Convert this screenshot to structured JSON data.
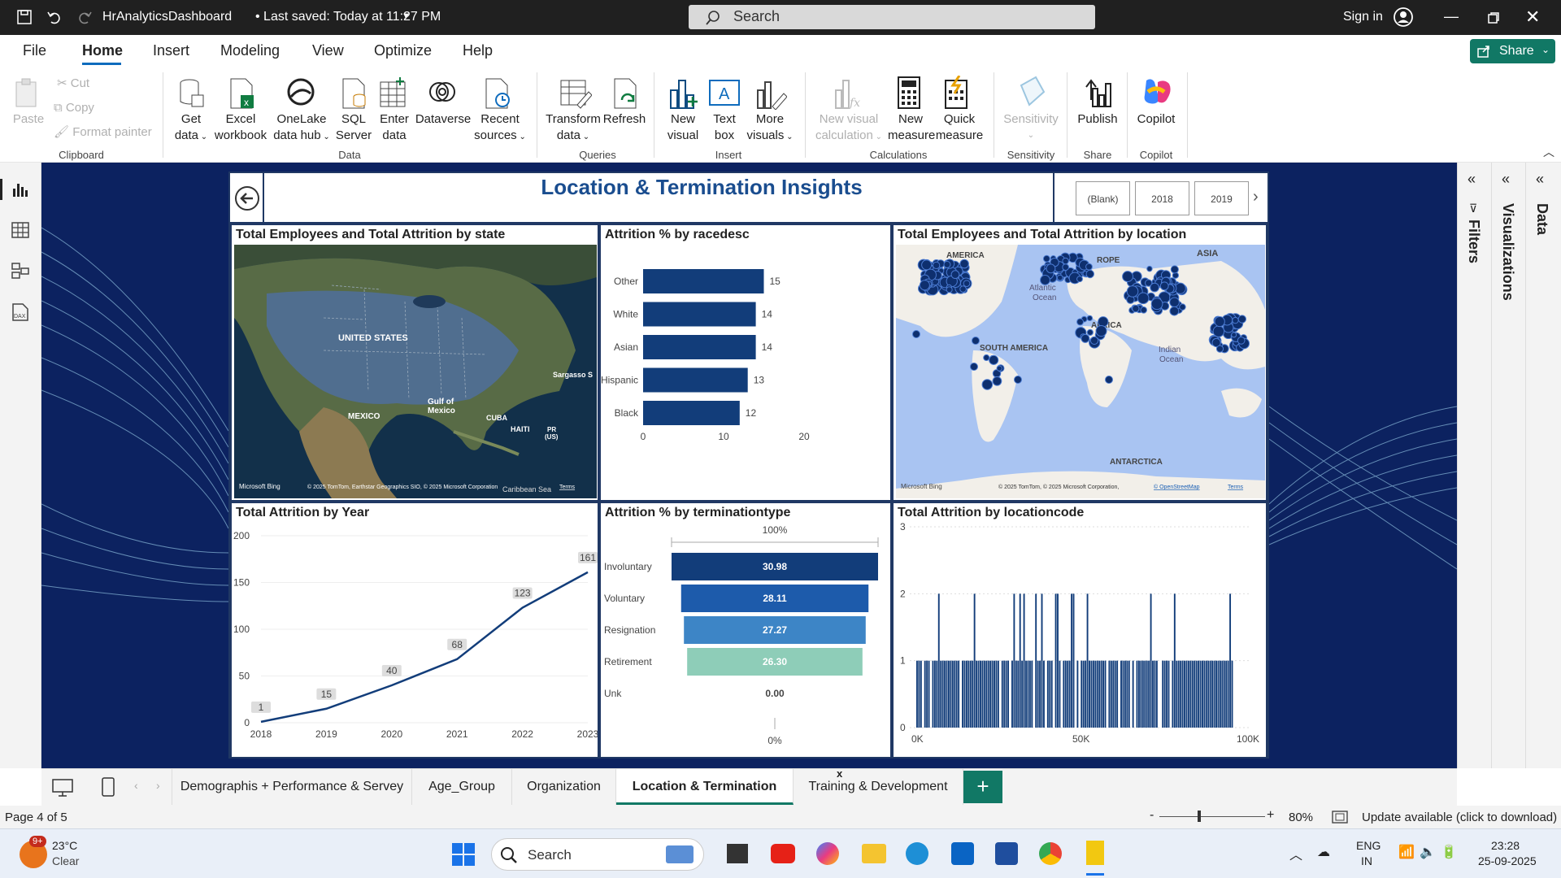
{
  "titlebar": {
    "title": "HrAnalyticsDashboard",
    "saved": "• Last saved: Today at 11:27 PM",
    "search": "Search",
    "signin": "Sign in"
  },
  "menu": {
    "items": [
      "File",
      "Home",
      "Insert",
      "Modeling",
      "View",
      "Optimize",
      "Help"
    ],
    "share": "Share"
  },
  "ribbon": {
    "clipboard": {
      "paste": "Paste",
      "cut": "Cut",
      "copy": "Copy",
      "format_painter": "Format painter",
      "group": "Clipboard"
    },
    "data": {
      "get_data": [
        "Get",
        "data"
      ],
      "excel": [
        "Excel",
        "workbook"
      ],
      "onelake": [
        "OneLake",
        "data hub"
      ],
      "sql": [
        "SQL",
        "Server"
      ],
      "enter": [
        "Enter",
        "data"
      ],
      "dataverse": "Dataverse",
      "recent": [
        "Recent",
        "sources"
      ],
      "group": "Data"
    },
    "queries": {
      "transform": [
        "Transform",
        "data"
      ],
      "refresh": "Refresh",
      "group": "Queries"
    },
    "insert": {
      "new_visual": [
        "New",
        "visual"
      ],
      "text_box": [
        "Text",
        "box"
      ],
      "more_visuals": [
        "More",
        "visuals"
      ],
      "group": "Insert"
    },
    "calculations": {
      "new_visual_calc": [
        "New visual",
        "calculation"
      ],
      "new_measure": [
        "New",
        "measure"
      ],
      "quick_measure": [
        "Quick",
        "measure"
      ],
      "group": "Calculations"
    },
    "sensitivity": {
      "label": "Sensitivity",
      "group": "Sensitivity"
    },
    "share": {
      "publish": "Publish",
      "group": "Share"
    },
    "copilot": {
      "label": "Copilot",
      "group": "Copilot"
    }
  },
  "report": {
    "title": "Location & Termination Insights",
    "slicer": [
      "(Blank)",
      "2018",
      "2019"
    ]
  },
  "panels": {
    "state_map": {
      "title": "Total Employees and Total Attrition by state",
      "labels": [
        "UNITED STATES",
        "MEXICO",
        "Gulf of",
        "Mexico",
        "CUBA",
        "HAITI",
        "PR",
        "(US)",
        "Sargasso S",
        "Caribbean Sea"
      ],
      "credit": "© 2025 TomTom, Earthstar Geographics SIO, © 2025 Microsoft Corporation",
      "terms": "Terms",
      "bing": "Microsoft Bing"
    },
    "world_map": {
      "title": "Total Employees and Total Attrition by location",
      "labels": [
        "ASIA",
        "ROPE",
        "AMERICA",
        "Atlantic",
        "Ocean",
        "AFRICA",
        "SOUTH AMERICA",
        "Indian",
        "Ocean",
        "ANTARCTICA"
      ],
      "credit": "© 2025 TomTom, © 2025 Microsoft Corporation,",
      "osm": "© OpenStreetMap",
      "terms": "Terms",
      "bing": "Microsoft Bing"
    },
    "year_title": "Total Attrition by Year",
    "race_title": "Attrition % by racedesc",
    "term_title": "Attrition % by terminationtype",
    "loc_title": "Total Attrition by locationcode"
  },
  "chart_data": [
    {
      "type": "bar",
      "orientation": "horizontal",
      "title": "Attrition % by racedesc",
      "categories": [
        "Other",
        "White",
        "Asian",
        "Hispanic",
        "Black"
      ],
      "values": [
        15,
        14,
        14,
        13,
        12
      ],
      "xlim": [
        0,
        20
      ],
      "xticks": [
        0,
        10,
        20
      ],
      "color": "#123d7a"
    },
    {
      "type": "line",
      "title": "Total Attrition by Year",
      "x": [
        "2018",
        "2019",
        "2020",
        "2021",
        "2022",
        "2023"
      ],
      "values": [
        1,
        15,
        40,
        68,
        123,
        161
      ],
      "ylim": [
        0,
        200
      ],
      "yticks": [
        0,
        50,
        100,
        150,
        200
      ],
      "color": "#123d7a"
    },
    {
      "type": "bar",
      "subtype": "funnel",
      "title": "Attrition % by terminationtype",
      "categories": [
        "Involuntary",
        "Voluntary",
        "Resignation",
        "Retirement",
        "Unk"
      ],
      "values": [
        30.98,
        28.11,
        27.27,
        26.3,
        0.0
      ],
      "value_labels": [
        "30.98",
        "28.11",
        "27.27",
        "26.30",
        "0.00"
      ],
      "top_label": "100%",
      "bottom_label": "0%",
      "colors": [
        "#123d7a",
        "#1d5bab",
        "#3d85c6",
        "#8ecdb8",
        "#cccccc"
      ]
    },
    {
      "type": "bar",
      "title": "Total Attrition by locationcode",
      "xticks": [
        "0K",
        "50K",
        "100K"
      ],
      "ylim": [
        0,
        3
      ],
      "yticks": [
        0,
        1,
        2,
        3
      ],
      "note": "dense column chart, most bars = 1, about 20 bars = 2, one bar = 3",
      "color": "#123d7a"
    }
  ],
  "tabs": [
    "Demographis + Performance & Servey",
    "Age_Group",
    "Organization",
    "Location & Termination Insights",
    "Training & Development"
  ],
  "active_tab": "Location & Termination Insights",
  "rightpanes": [
    "Filters",
    "Visualizations",
    "Data"
  ],
  "status": {
    "page": "Page 4 of 5",
    "zoom": "80%",
    "update": "Update available (click to download)"
  },
  "taskbar": {
    "temp": "23°C",
    "weather": "Clear",
    "badge": "9+",
    "search": "Search",
    "lang1": "ENG",
    "lang2": "IN",
    "time": "23:28",
    "date": "25-09-2025"
  }
}
